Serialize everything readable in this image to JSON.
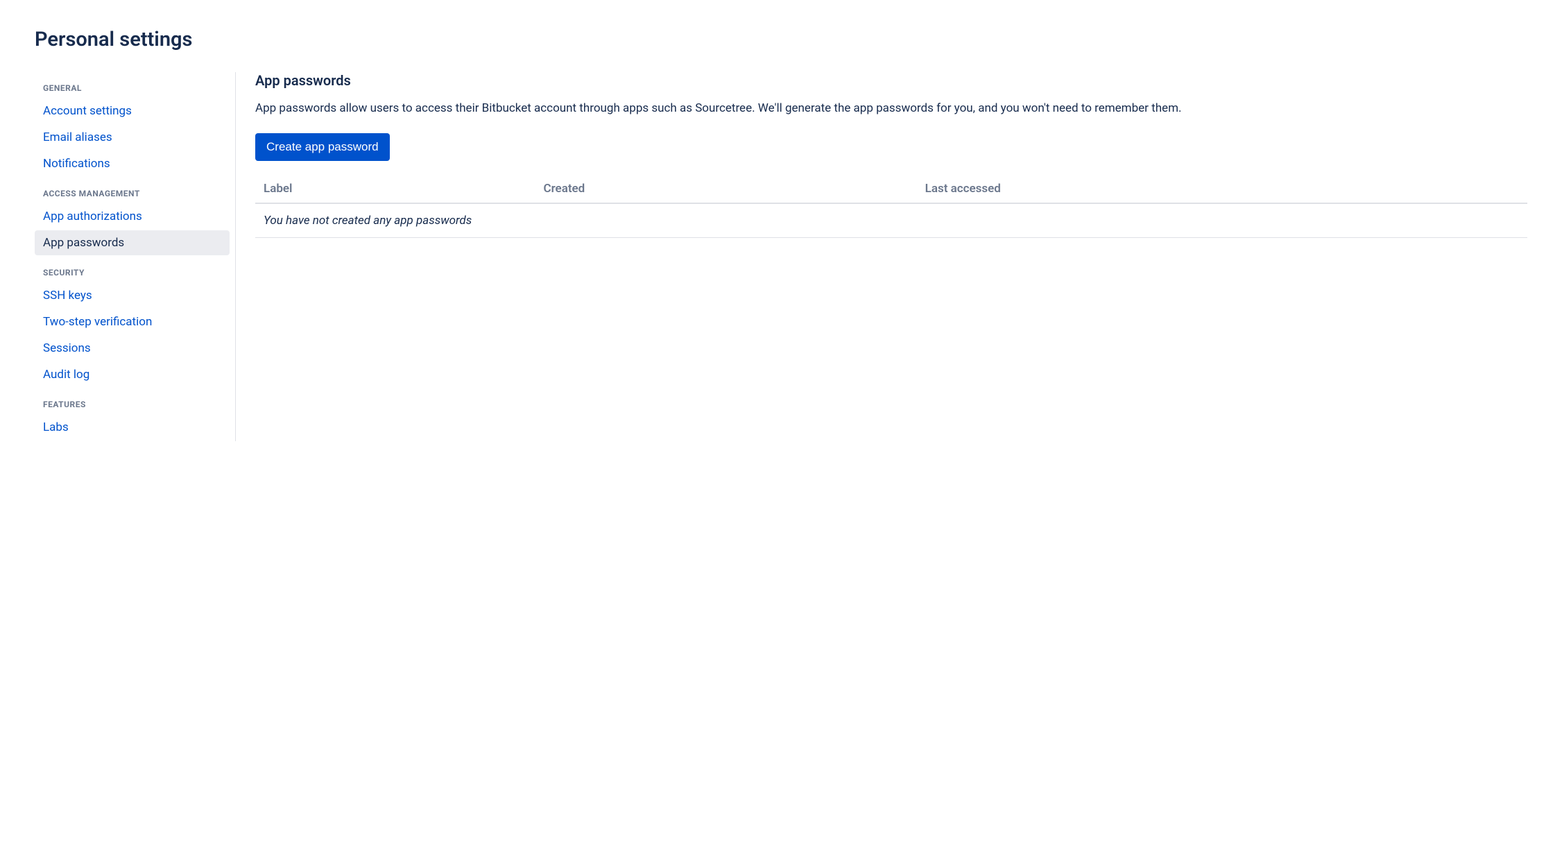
{
  "page_title": "Personal settings",
  "sidebar": {
    "sections": [
      {
        "heading": "GENERAL",
        "items": [
          {
            "label": "Account settings",
            "active": false
          },
          {
            "label": "Email aliases",
            "active": false
          },
          {
            "label": "Notifications",
            "active": false
          }
        ]
      },
      {
        "heading": "ACCESS MANAGEMENT",
        "items": [
          {
            "label": "App authorizations",
            "active": false
          },
          {
            "label": "App passwords",
            "active": true
          }
        ]
      },
      {
        "heading": "SECURITY",
        "items": [
          {
            "label": "SSH keys",
            "active": false
          },
          {
            "label": "Two-step verification",
            "active": false
          },
          {
            "label": "Sessions",
            "active": false
          },
          {
            "label": "Audit log",
            "active": false
          }
        ]
      },
      {
        "heading": "FEATURES",
        "items": [
          {
            "label": "Labs",
            "active": false
          }
        ]
      }
    ]
  },
  "main": {
    "title": "App passwords",
    "description": "App passwords allow users to access their Bitbucket account through apps such as Sourcetree. We'll generate the app passwords for you, and you won't need to remember them.",
    "create_button": "Create app password",
    "table": {
      "headers": [
        "Label",
        "Created",
        "Last accessed"
      ],
      "empty_message": "You have not created any app passwords"
    }
  }
}
